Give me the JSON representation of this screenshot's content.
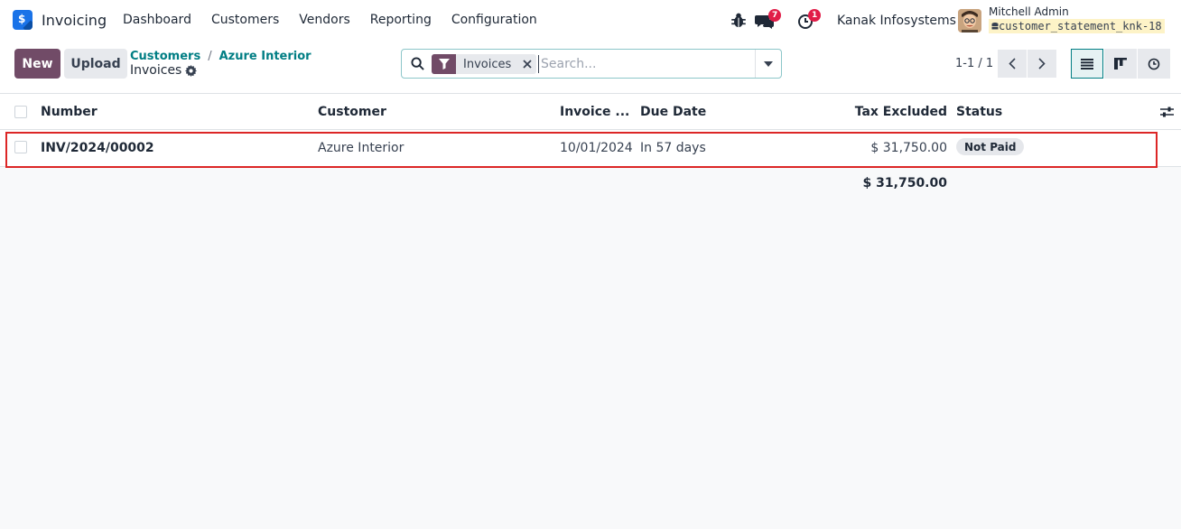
{
  "app": {
    "name": "Invoicing",
    "logo_glyph": "$",
    "brand_color": "#1a73e8",
    "accent_color": "#714b67",
    "link_color": "#017e84"
  },
  "menu": [
    "Dashboard",
    "Customers",
    "Vendors",
    "Reporting",
    "Configuration"
  ],
  "systray": {
    "debug_icon": "bug-icon",
    "messages_icon": "chat-icon",
    "messages_count": "7",
    "activities_icon": "clock-icon",
    "activities_count": "1",
    "company": "Kanak Infosystems",
    "user_name": "Mitchell Admin",
    "database": "customer_statement_knk-18"
  },
  "control": {
    "new_label": "New",
    "upload_label": "Upload",
    "breadcrumb": [
      "Customers",
      "Azure Interior"
    ],
    "current": "Invoices",
    "settings_icon": "gear-icon"
  },
  "search": {
    "facet_icon": "filter-icon",
    "facet_label": "Invoices",
    "placeholder": "Search...",
    "value": ""
  },
  "pager": {
    "text": "1-1 / 1"
  },
  "views": [
    "list-view",
    "kanban-view",
    "activity-view"
  ],
  "table": {
    "columns": {
      "number": "Number",
      "customer": "Customer",
      "invoice_date": "Invoice ...",
      "due_date": "Due Date",
      "tax_excluded": "Tax Excluded",
      "status": "Status"
    },
    "rows": [
      {
        "number": "INV/2024/00002",
        "customer": "Azure Interior",
        "invoice_date": "10/01/2024",
        "due_date": "In 57 days",
        "tax_excluded": "$ 31,750.00",
        "status": "Not Paid"
      }
    ],
    "total": "$ 31,750.00"
  }
}
